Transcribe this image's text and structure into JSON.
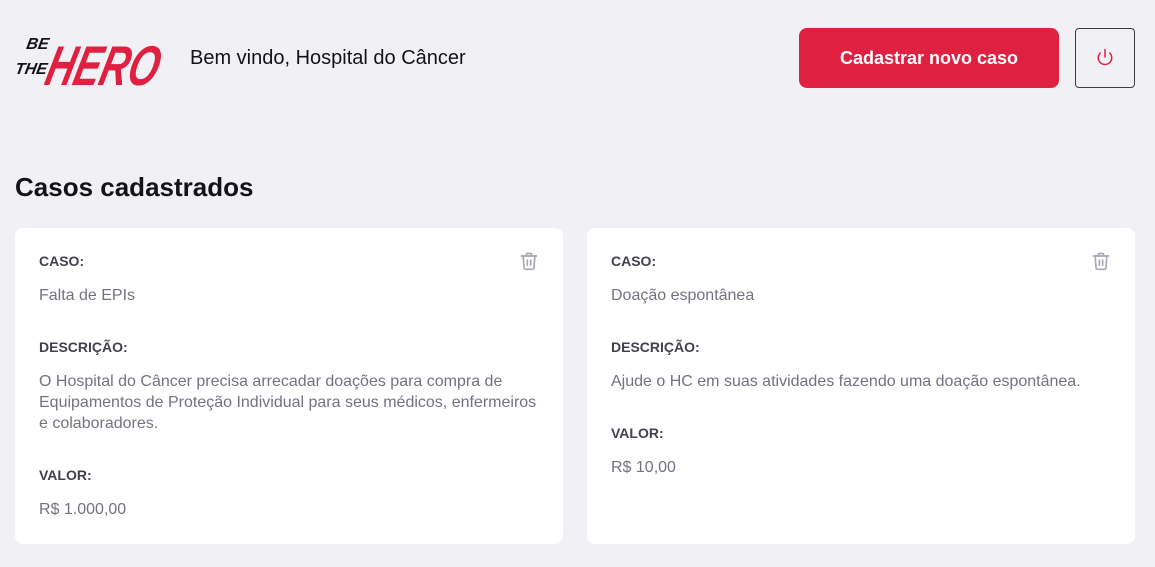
{
  "header": {
    "logo": {
      "line1": "BE",
      "line2": "THE",
      "word": "HERO"
    },
    "welcome": "Bem vindo, Hospital do Câncer",
    "new_case_label": "Cadastrar novo caso",
    "logout_icon": "power-icon"
  },
  "main": {
    "title": "Casos cadastrados",
    "cases": [
      {
        "case_label": "CASO:",
        "case_value": "Falta de EPIs",
        "description_label": "DESCRIÇÃO:",
        "description_value": "O Hospital do Câncer precisa arrecadar doações para compra de Equipamentos de Proteção Individual para seus médicos, enfermeiros e colaboradores.",
        "value_label": "VALOR:",
        "value_value": "R$ 1.000,00",
        "delete_icon": "trash-icon"
      },
      {
        "case_label": "CASO:",
        "case_value": "Doação espontânea",
        "description_label": "DESCRIÇÃO:",
        "description_value": "Ajude o HC em suas atividades fazendo uma doação espontânea.",
        "value_label": "VALOR:",
        "value_value": "R$ 10,00",
        "delete_icon": "trash-icon"
      }
    ]
  },
  "colors": {
    "background": "#f0f0f5",
    "brand_red": "#e02041",
    "text_dark": "#13131a",
    "label": "#41414d",
    "muted": "#737380"
  }
}
